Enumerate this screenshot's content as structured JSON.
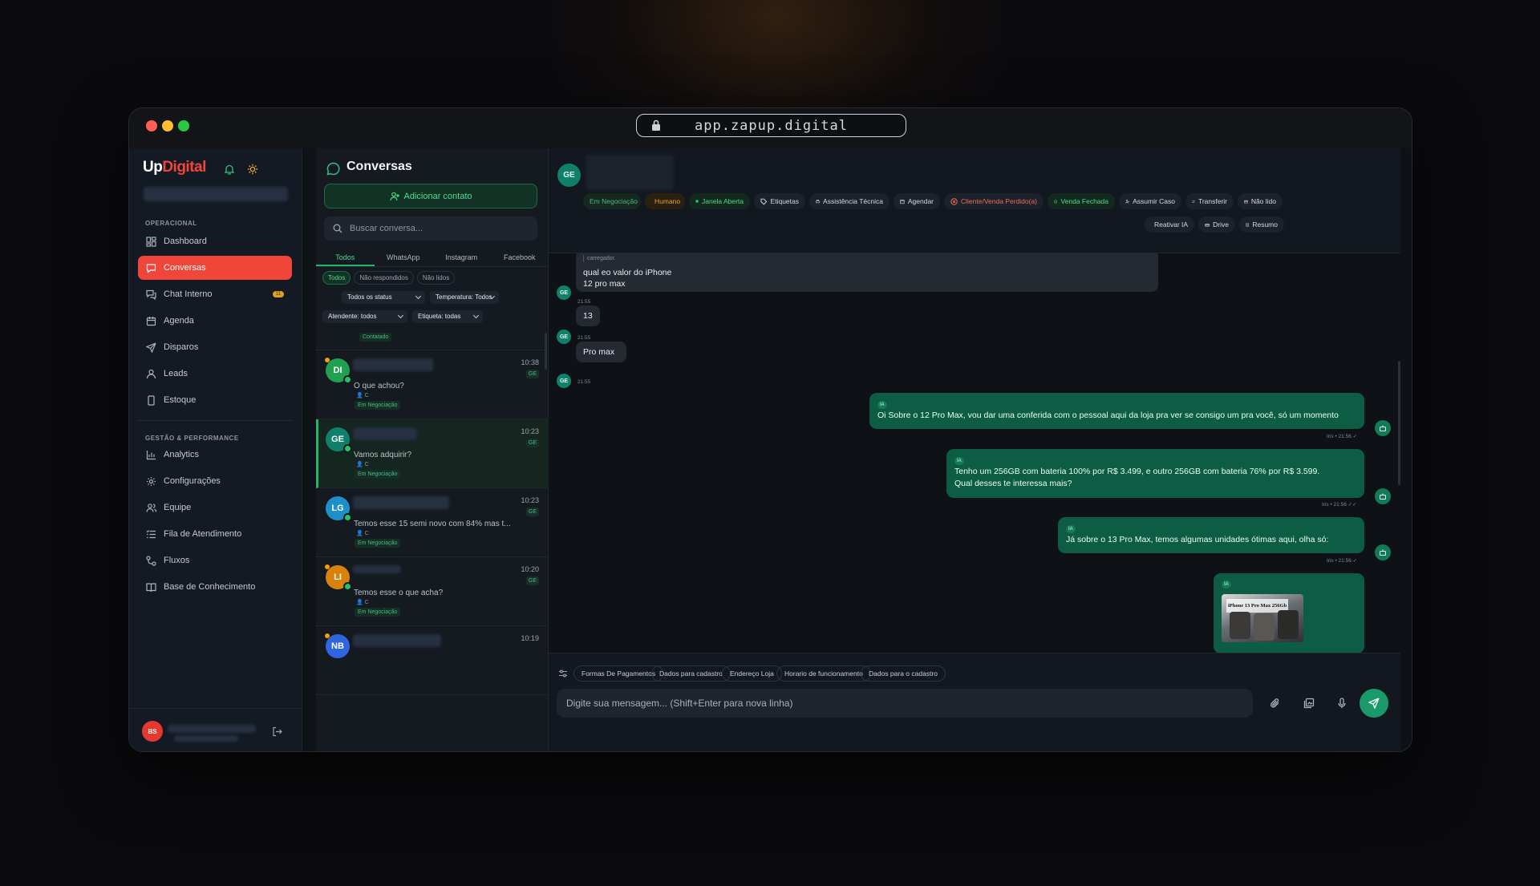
{
  "browser": {
    "url": "app.zapup.digital"
  },
  "brand": {
    "up": "Up",
    "digital": "Digital"
  },
  "sidebar": {
    "section_ops": "OPERACIONAL",
    "section_mgmt": "GESTÃO & PERFORMANCE",
    "items": [
      {
        "label": "Dashboard",
        "icon": "dashboard-icon"
      },
      {
        "label": "Conversas",
        "icon": "chat-icon"
      },
      {
        "label": "Chat Interno",
        "icon": "messages-icon"
      },
      {
        "label": "Agenda",
        "icon": "calendar-icon"
      },
      {
        "label": "Disparos",
        "icon": "send-icon"
      },
      {
        "label": "Leads",
        "icon": "user-icon"
      },
      {
        "label": "Estoque",
        "icon": "phone-icon"
      },
      {
        "label": "Analytics",
        "icon": "bar-chart-icon"
      },
      {
        "label": "Configurações",
        "icon": "gear-icon"
      },
      {
        "label": "Equipe",
        "icon": "users-icon"
      },
      {
        "label": "Fila de Atendimento",
        "icon": "list-icon"
      },
      {
        "label": "Fluxos",
        "icon": "flow-icon"
      },
      {
        "label": "Base de Conhecimento",
        "icon": "book-icon"
      }
    ],
    "chat_badge": "11",
    "user_initials": "BS"
  },
  "conversations": {
    "title": "Conversas",
    "add_label": "Adicionar contato",
    "search_placeholder": "Buscar conversa...",
    "tabs": [
      "Todos",
      "WhatsApp",
      "Instagram",
      "Facebook"
    ],
    "filter_chips": [
      "Todos",
      "Não respondidos",
      "Não lidos"
    ],
    "status_select": "Todos os status",
    "temp_select": "Temperatura: Todos",
    "agent_select": "Atendente: todos",
    "tag_select": "Etiqueta: todas",
    "partial_stage": "Contatado",
    "items": [
      {
        "initials": "DI",
        "time": "10:38",
        "tag": "GE",
        "message": "O que achou?",
        "sub": "C",
        "stage": "Em Negociação",
        "color": "#21a150"
      },
      {
        "initials": "GE",
        "time": "10:23",
        "tag": "GE",
        "message": "Vamos adquirir?",
        "sub": "C",
        "stage": "Em Negociação",
        "color": "#11806a"
      },
      {
        "initials": "LG",
        "time": "10:23",
        "tag": "GE",
        "message": "Temos esse 15 semi novo com 84% mas t...",
        "sub": "C",
        "stage": "Em Negociação",
        "color": "#1d8fc9"
      },
      {
        "initials": "LI",
        "time": "10:20",
        "tag": "GE",
        "message": "Temos esse o que acha?",
        "sub": "C",
        "stage": "Em Negociação",
        "color": "#d9820b"
      },
      {
        "initials": "NB",
        "time": "10:19",
        "tag": "",
        "message": "",
        "sub": "",
        "stage": "",
        "color": "#2f66e0"
      }
    ]
  },
  "chat": {
    "contact_initials": "GE",
    "actions_row1": [
      {
        "label": "Em Negociação",
        "style": "neg"
      },
      {
        "label": "Humano",
        "style": "human"
      },
      {
        "label": "Janela Aberta",
        "style": "open"
      },
      {
        "label": "Etiquetas",
        "style": "plain"
      },
      {
        "label": "Assistência Técnica",
        "style": "plain"
      },
      {
        "label": "Agendar",
        "style": "plain"
      },
      {
        "label": "Cliente/Venda Perdido(a)",
        "style": "lost"
      },
      {
        "label": "Venda Fechada",
        "style": "won"
      },
      {
        "label": "Assumir Caso",
        "style": "plain"
      },
      {
        "label": "Transferir",
        "style": "plain"
      },
      {
        "label": "Não lido",
        "style": "plain"
      }
    ],
    "actions_row2": [
      "Reativar IA",
      "Drive",
      "Resumo"
    ],
    "messages": {
      "m0_top": "carregador.",
      "m0_line1": "qual eo valor do iPhone",
      "m0_line2": "12 pro max",
      "m0_time": "21:55",
      "m1": "13",
      "m1_time": "21:55",
      "m2": "Pro max",
      "m2_time": "21:55",
      "ia_badge": "IA",
      "o1": "Oi Sobre o 12 Pro Max, vou dar uma conferida com o pessoal aqui da loja pra ver se consigo um pra você, só um momento",
      "o1_meta": "Iris • 21:56 ✓",
      "o2_line1": "Tenho um 256GB com bateria 100% por R$ 3.499, e outro 256GB com bateria 76% por R$ 3.599.",
      "o2_line2": "Qual desses te interessa mais?",
      "o2_meta": "Iris • 21:56 ✓✓",
      "o3": "Já sobre o 13 Pro Max, temos algumas unidades ótimas aqui, olha só:",
      "o3_meta": "Iris • 21:56 ✓",
      "image_caption": "iPhone 13 Pro Max 256Gb"
    },
    "quick_replies": [
      "Formas De Pagamentos",
      "Dados para cadastro",
      "Endereço Loja",
      "Horario de funcionamento",
      "Dados para o cadastro"
    ],
    "composer_placeholder": "Digite sua mensagem... (Shift+Enter para nova linha)"
  },
  "colors": {
    "brand_red": "#f0463a",
    "accent_green": "#23b46a",
    "bubble_out": "#0c5d44"
  }
}
